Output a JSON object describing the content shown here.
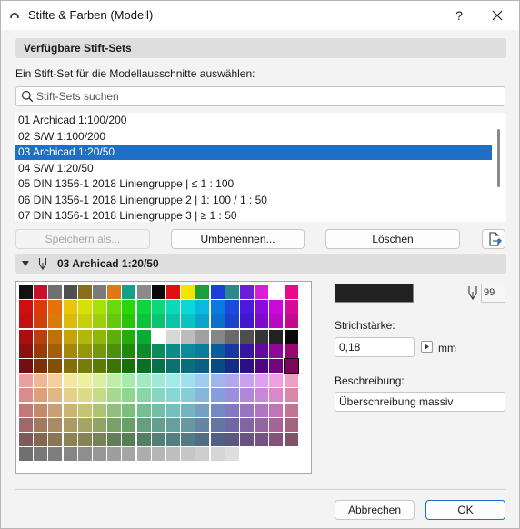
{
  "window": {
    "title": "Stifte & Farben (Modell)",
    "help": "?"
  },
  "sets_section": {
    "header": "Verfügbare Stift-Sets",
    "instruction": "Ein Stift-Set für die Modellausschnitte auswählen:"
  },
  "search": {
    "placeholder": "Stift-Sets suchen",
    "value": ""
  },
  "penset_list": {
    "selected_index": 2,
    "items": [
      "01 Archicad 1:100/200",
      "02 S/W 1:100/200",
      "03 Archicad 1:20/50",
      "04 S/W 1:20/50",
      "05 DIN 1356-1 2018 Liniengruppe | ≤ 1 : 100",
      "06 DIN 1356-1 2018 Liniengruppe 2 | 1: 100 / 1 : 50",
      "07 DIN 1356-1 2018 Liniengruppe 3 | ≥ 1 : 50"
    ]
  },
  "buttons": {
    "save_as": "Speichern als...",
    "rename": "Umbenennen...",
    "delete": "Löschen",
    "cancel": "Abbrechen",
    "ok": "OK"
  },
  "current_set": {
    "name": "03 Archicad 1:20/50"
  },
  "pen": {
    "number": "99",
    "color": "#222222",
    "weight_label": "Strichstärke:",
    "weight_value": "0,18",
    "weight_unit": "mm",
    "description_label": "Beschreibung:",
    "description_value": "Überschreibung massiv"
  },
  "palette": {
    "selected": [
      5,
      18
    ],
    "rows": [
      [
        "#111111",
        "#c8102e",
        "#707070",
        "#505050",
        "#8a6d1a",
        "#7a7a7a",
        "#e07818",
        "#16a08a",
        "#8a8a8a",
        "#0a0a0a",
        "#e01010",
        "#f5e400",
        "#1a9f3a",
        "#1a3fd6",
        "#2a8a8a",
        "#6a1fd6",
        "#d81fd6",
        "#ffffff",
        "#e80a8a"
      ],
      [
        "#cc1010",
        "#dd3a0a",
        "#e8700a",
        "#ecc40a",
        "#d8e00a",
        "#a8e00a",
        "#6ad80a",
        "#2ad80a",
        "#0ad83a",
        "#0ad87a",
        "#0ad8b8",
        "#0ad8d8",
        "#0ab8e0",
        "#0a7ae0",
        "#1a4ae0",
        "#4a1ae0",
        "#8a0ae0",
        "#c80ad8",
        "#d80a9a"
      ],
      [
        "#c01010",
        "#d0400a",
        "#da7a0a",
        "#dcba0a",
        "#c8d00a",
        "#9cd00a",
        "#66c80a",
        "#28c40a",
        "#0ac43a",
        "#0ac474",
        "#0ac4aa",
        "#0ac4c4",
        "#0aa4cc",
        "#0a70cc",
        "#1a42cc",
        "#4218cc",
        "#7e0acc",
        "#b80ac4",
        "#c40a8c"
      ],
      [
        "#a81010",
        "#b8400a",
        "#c0700a",
        "#c4a40a",
        "#b0b80a",
        "#8cb80a",
        "#5cb00a",
        "#24ac0a",
        "#0aac34",
        "#ffffff",
        "#d8d8d8",
        "#bcbcbc",
        "#a0a0a0",
        "#868686",
        "#6a6a6a",
        "#4e4e4e",
        "#363636",
        "#222222",
        "#0a0a0a"
      ],
      [
        "#8c1010",
        "#9a3a0a",
        "#a0600a",
        "#a4880a",
        "#94980a",
        "#74980a",
        "#4c900a",
        "#1e8c0a",
        "#0a8c2c",
        "#0a8c5a",
        "#0a8c88",
        "#0a8c9a",
        "#0a7c9c",
        "#0a5ca0",
        "#1a36a0",
        "#3414a0",
        "#6408a0",
        "#900898",
        "#980870"
      ],
      [
        "#701010",
        "#7c300a",
        "#80500a",
        "#84700a",
        "#787c0a",
        "#5c7c0a",
        "#3c740a",
        "#18700a",
        "#0a7024",
        "#0a704a",
        "#0a7070",
        "#0a6c7c",
        "#0a607e",
        "#0a4a82",
        "#142c82",
        "#2a1082",
        "#500682",
        "#74067c",
        "#7c065a"
      ],
      [
        "#e8a0a0",
        "#ecb896",
        "#f0d0a0",
        "#f4e8a0",
        "#eef0a0",
        "#d8f0a0",
        "#c0ecaa",
        "#a8eaaa",
        "#a0eac0",
        "#a0ead8",
        "#a0eaea",
        "#a0e0ee",
        "#a0ccee",
        "#a0b4ee",
        "#b0a8ee",
        "#c8a0ee",
        "#e0a0ee",
        "#eea0e0",
        "#eea0c0"
      ],
      [
        "#d88c8c",
        "#dca07c",
        "#e0b888",
        "#e4d088",
        "#dcdc88",
        "#c4dc88",
        "#a8d890",
        "#90d690",
        "#88d6a8",
        "#88d6c0",
        "#88d6d6",
        "#88ccda",
        "#88b6da",
        "#889eda",
        "#9890da",
        "#b088da",
        "#c888da",
        "#da88cc",
        "#da88aa"
      ],
      [
        "#c07878",
        "#c48a6a",
        "#c8a074",
        "#ccb474",
        "#c4c474",
        "#acc474",
        "#92c07c",
        "#7cbe7c",
        "#74be92",
        "#74bea8",
        "#74bebe",
        "#74b4c2",
        "#749ec2",
        "#7488c2",
        "#8478c2",
        "#9a74c2",
        "#b074c2",
        "#c274b4",
        "#c27494"
      ],
      [
        "#a06868",
        "#a47a5c",
        "#a88c64",
        "#ac9c64",
        "#a4a464",
        "#90a464",
        "#7aa06a",
        "#68a068",
        "#64a07c",
        "#64a090",
        "#64a0a0",
        "#6498a4",
        "#6486a4",
        "#6474a4",
        "#7068a4",
        "#8264a4",
        "#9464a4",
        "#a46498",
        "#a4647e"
      ],
      [
        "#805a5a",
        "#84684e",
        "#887654",
        "#8c8254",
        "#848454",
        "#748454",
        "#628058",
        "#548054",
        "#528064",
        "#528074",
        "#528080",
        "#527a84",
        "#526c84",
        "#525e84",
        "#5c5684",
        "#6a5284",
        "#785284",
        "#84527a",
        "#845266"
      ],
      [
        "#707070",
        "#787878",
        "#7e7e7e",
        "#868686",
        "#8e8e8e",
        "#969696",
        "#9e9e9e",
        "#a6a6a6",
        "#aeaeae",
        "#b6b6b6",
        "#bebebe",
        "#c6c6c6",
        "#cecece",
        "#d6d6d6",
        "#dedede"
      ]
    ]
  }
}
